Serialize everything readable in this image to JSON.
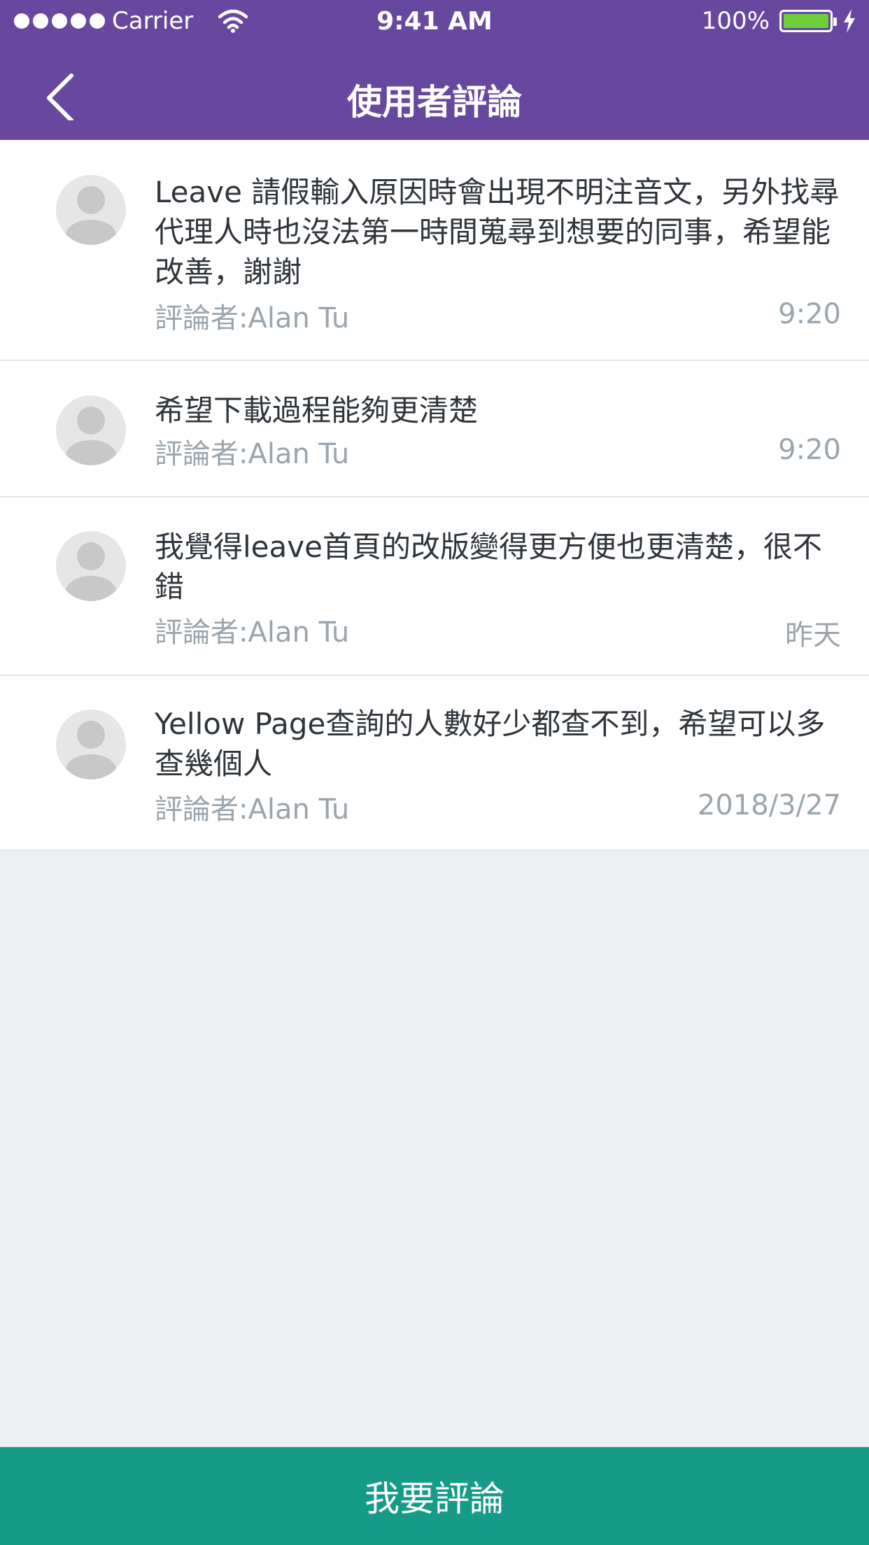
{
  "status_bar": {
    "carrier": "Carrier",
    "time": "9:41 AM",
    "battery": "100%"
  },
  "nav": {
    "title": "使用者評論",
    "back_icon": "chevron-left-icon"
  },
  "comments": [
    {
      "text": "Leave 請假輸入原因時會出現不明注音文，另外找尋代理人時也沒法第一時間蒐尋到想要的同事，希望能改善，謝謝",
      "author": "評論者:Alan Tu",
      "time": "9:20"
    },
    {
      "text": "希望下載過程能夠更清楚",
      "author": "評論者:Alan Tu",
      "time": "9:20"
    },
    {
      "text": "我覺得leave首頁的改版變得更方便也更清楚，很不錯",
      "author": "評論者:Alan Tu",
      "time": "昨天"
    },
    {
      "text": "Yellow Page查詢的人數好少都查不到，希望可以多查幾個人",
      "author": "評論者:Alan Tu",
      "time": "2018/3/27"
    }
  ],
  "footer": {
    "button_label": "我要評論"
  },
  "colors": {
    "header": "#67489e",
    "footer_button": "#169b89",
    "background": "#edf0f3",
    "battery": "#6fcf3a"
  }
}
